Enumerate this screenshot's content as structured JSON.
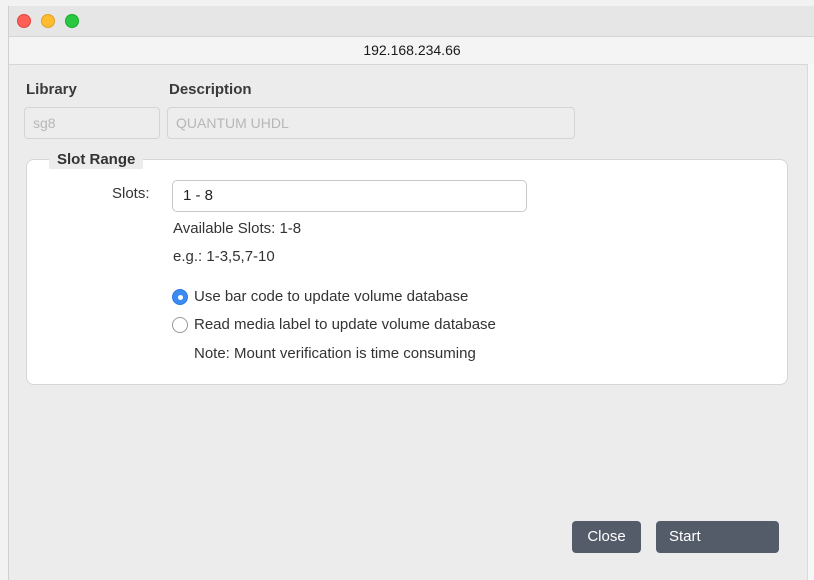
{
  "window": {
    "host": "192.168.234.66"
  },
  "library": {
    "label": "Library",
    "value": "sg8"
  },
  "description": {
    "label": "Description",
    "value": "QUANTUM UHDL"
  },
  "slot_range": {
    "title": "Slot Range",
    "slots_label": "Slots:",
    "slots_value": "1 - 8",
    "available": "Available Slots: 1-8",
    "example": "e.g.: 1-3,5,7-10",
    "options": [
      {
        "label": "Use bar code to update volume database",
        "selected": true
      },
      {
        "label": "Read media label to update volume database",
        "selected": false
      }
    ],
    "note": "Note: Mount verification is time consuming"
  },
  "buttons": {
    "close": "Close",
    "start": "Start"
  },
  "colors": {
    "accent": "#3b8bf4",
    "button": "#555c69"
  }
}
